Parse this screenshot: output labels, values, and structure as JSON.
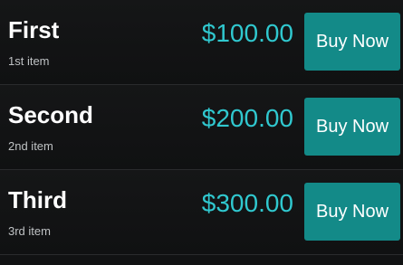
{
  "items": [
    {
      "title": "First",
      "subtitle": "1st item",
      "price": "$100.00",
      "button_label": "Buy Now"
    },
    {
      "title": "Second",
      "subtitle": "2nd item",
      "price": "$200.00",
      "button_label": "Buy Now"
    },
    {
      "title": "Third",
      "subtitle": "3rd item",
      "price": "$300.00",
      "button_label": "Buy Now"
    }
  ],
  "colors": {
    "background": "#111213",
    "price_text": "#30c8cf",
    "button_bg": "#138a88",
    "title_text": "#ffffff",
    "subtitle_text": "#bfc2c4"
  }
}
